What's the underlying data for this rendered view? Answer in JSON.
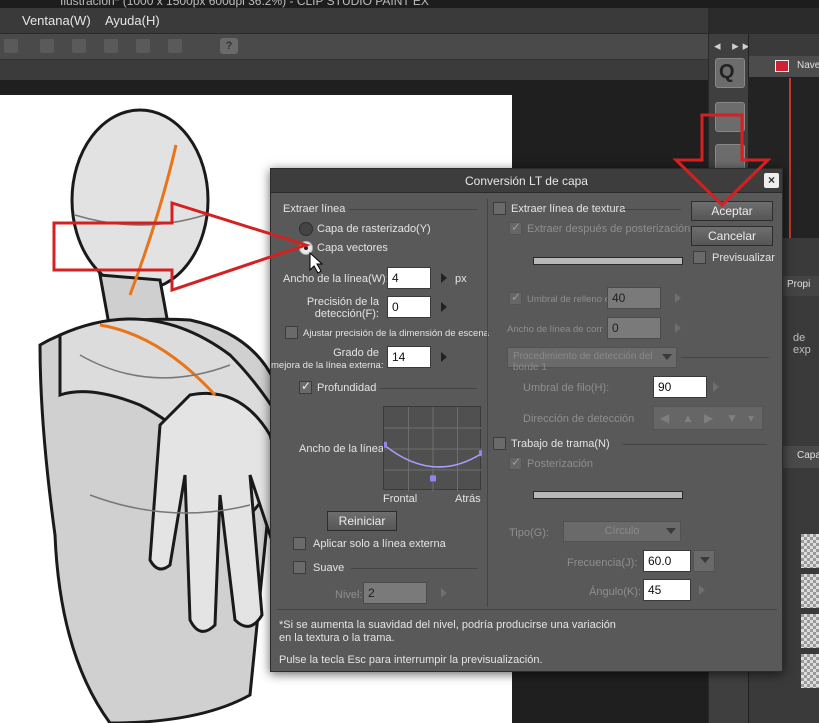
{
  "app": {
    "title_fragment": "Ilustración* (1000 x 1500px 600dpi 36.2%) - CLIP STUDIO PAINT EX",
    "menu": [
      "Ventana(W)",
      "Ayuda(H)"
    ],
    "help_label": "?",
    "right_panel": {
      "navigator_label": "Naveg",
      "properties_label": "Propi",
      "properties_text": "de exp",
      "layers_label": "Capa"
    }
  },
  "dialog": {
    "title": "Conversión LT de capa",
    "close_label": "×",
    "buttons": {
      "ok": "Aceptar",
      "cancel": "Cancelar",
      "reset": "Reiniciar"
    },
    "preview_label": "Previsualizar",
    "extract_line": {
      "section": "Extraer línea",
      "options": [
        "Capa de rasterizado(Y)",
        "Capa vectores"
      ],
      "selected": "Capa vectores",
      "line_width_label": "Ancho de la línea(W):",
      "line_width_value": "4",
      "line_width_unit": "px",
      "precision_label_1": "Precisión de la",
      "precision_label_2": "detección(F):",
      "precision_value": "0",
      "adjust_scene_label": "Ajustar precisión de la dimensión de escena",
      "adjust_scene_checked": false,
      "outer_line_label_1": "Grado de",
      "outer_line_label_2": "mejora de la línea externa:",
      "outer_line_value": "14",
      "depth_label": "Profundidad",
      "depth_checked": true,
      "graph_y_label": "Ancho de la línea",
      "graph_x_left": "Frontal",
      "graph_x_right": "Atrás",
      "curve_points": [
        [
          0,
          0.45
        ],
        [
          0.5,
          0.85
        ],
        [
          1.0,
          0.55
        ]
      ],
      "outer_only_label": "Aplicar solo a línea externa",
      "outer_only_checked": false,
      "smooth_label": "Suave",
      "smooth_checked": false,
      "level_label": "Nivel:",
      "level_value": "2"
    },
    "texture": {
      "section": "Extraer línea de textura",
      "section_checked": false,
      "after_poster_label": "Extraer después de posterización",
      "after_poster_checked": true,
      "fill_threshold_label": "Umbral de relleno en",
      "fill_threshold_checked": true,
      "fill_threshold_value": "40",
      "line_width_corr_label": "Ancho de línea de corr",
      "line_width_corr_value": "0",
      "edge_method": "Procedimiento de detección del borde 1",
      "edge_threshold_label": "Umbral de filo(H):",
      "edge_threshold_value": "90",
      "direction_label": "Dirección de detección"
    },
    "tone": {
      "section": "Trabajo de trama(N)",
      "section_checked": false,
      "posterize_label": "Posterización",
      "posterize_checked": true,
      "type_label": "Tipo(G):",
      "type_value": "Círculo",
      "frequency_label": "Frecuencia(J):",
      "frequency_value": "60.0",
      "angle_label": "Ángulo(K):",
      "angle_value": "45"
    },
    "notes": [
      "*Si se aumenta la suavidad del nivel, podría producirse una variación",
      "en la textura o la trama.",
      "Pulse la tecla Esc para interrumpir la previsualización."
    ]
  },
  "colors": {
    "annotation_red": "#d42020",
    "dialog_bg": "#595959",
    "accent_orange": "#e8751a",
    "curve_color": "#a8a0ff"
  }
}
